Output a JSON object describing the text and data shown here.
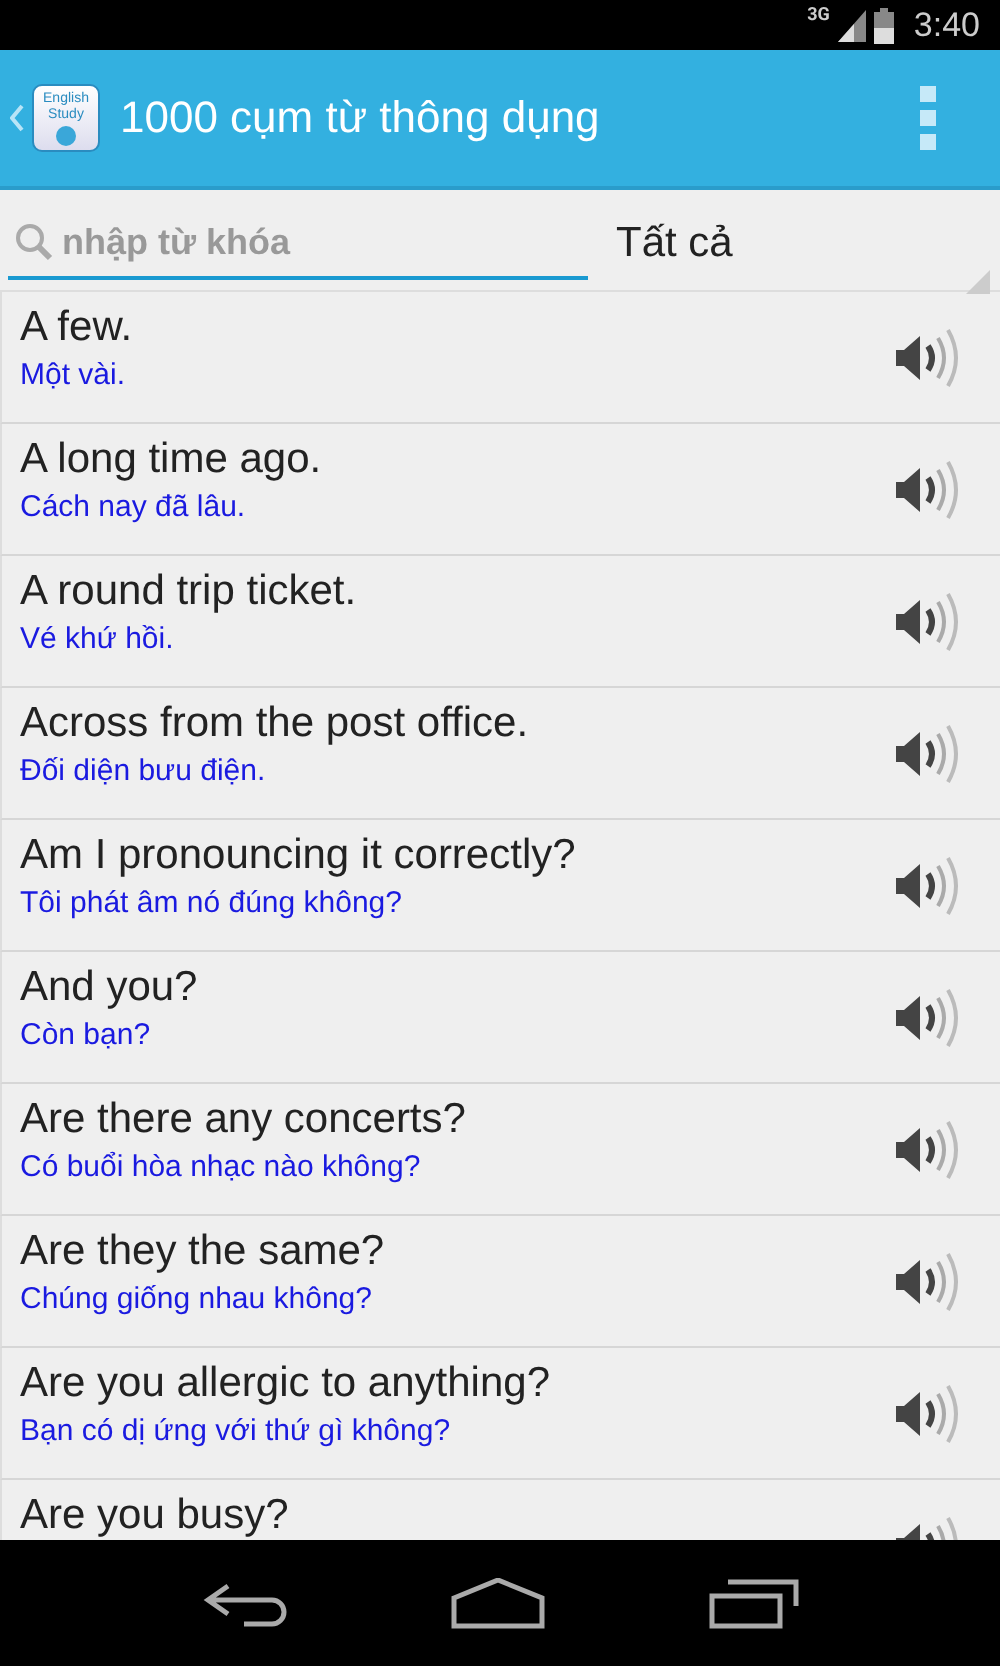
{
  "status_bar": {
    "network": "3G",
    "time": "3:40"
  },
  "action_bar": {
    "app_icon_text": [
      "English",
      "Study"
    ],
    "title": "1000 cụm từ thông dụng"
  },
  "search": {
    "placeholder": "nhập từ khóa"
  },
  "filter": {
    "value": "Tất cả"
  },
  "phrases": [
    {
      "english": "A few.",
      "vietnamese": "Một vài."
    },
    {
      "english": "A long time ago.",
      "vietnamese": "Cách nay đã lâu."
    },
    {
      "english": "A round trip ticket.",
      "vietnamese": "Vé khứ hồi."
    },
    {
      "english": "Across from the post office.",
      "vietnamese": "Đối diện bưu điện."
    },
    {
      "english": "Am I pronouncing it correctly?",
      "vietnamese": "Tôi phát âm nó đúng không?"
    },
    {
      "english": "And you?",
      "vietnamese": "Còn bạn?"
    },
    {
      "english": "Are there any concerts?",
      "vietnamese": "Có buổi hòa nhạc nào không?"
    },
    {
      "english": "Are they the same?",
      "vietnamese": "Chúng giống nhau không?"
    },
    {
      "english": "Are you allergic to anything?",
      "vietnamese": "Bạn có dị ứng với thứ gì không?"
    },
    {
      "english": "Are you busy?"
    }
  ]
}
